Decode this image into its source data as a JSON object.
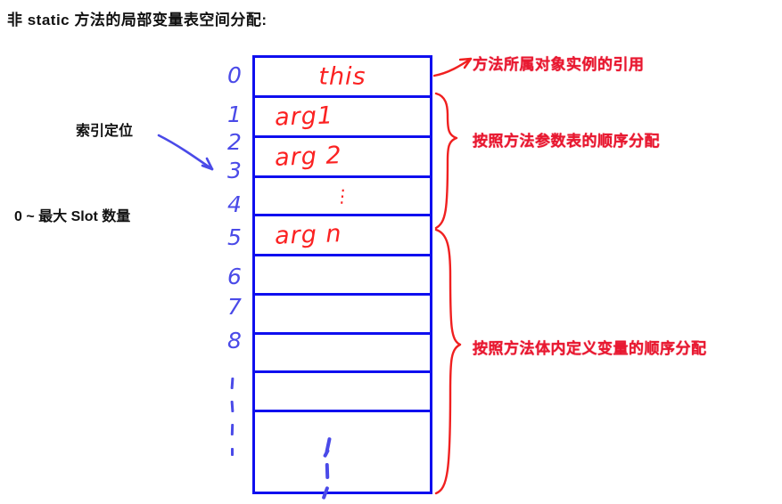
{
  "title": "非 static 方法的局部变量表空间分配:",
  "labels": {
    "index_locate": "索引定位",
    "slot_range": "0 ~ 最大 Slot 数量"
  },
  "colors": {
    "table_border": "#0f0fef",
    "index_text": "#4a4ae8",
    "cell_text": "#fb2222",
    "annotation": "#e81830",
    "title_text": "#111111",
    "background": "#ffffff"
  },
  "slot_table": {
    "rows": [
      {
        "index": "0",
        "value": "this"
      },
      {
        "index": "1",
        "value": "arg1"
      },
      {
        "index": "2",
        "value": "arg 2"
      },
      {
        "index": "3",
        "value": "⋮"
      },
      {
        "index": "4",
        "value": "arg n"
      },
      {
        "index": "5",
        "value": ""
      },
      {
        "index": "6",
        "value": ""
      },
      {
        "index": "7",
        "value": ""
      },
      {
        "index": "8",
        "value": ""
      },
      {
        "index": "⋮",
        "value": "⋮"
      }
    ]
  },
  "annotations": {
    "this_ref": "方法所属对象实例的引用",
    "params_order": "按照方法参数表的顺序分配",
    "locals_order": "按照方法体内定义变量的顺序分配"
  }
}
